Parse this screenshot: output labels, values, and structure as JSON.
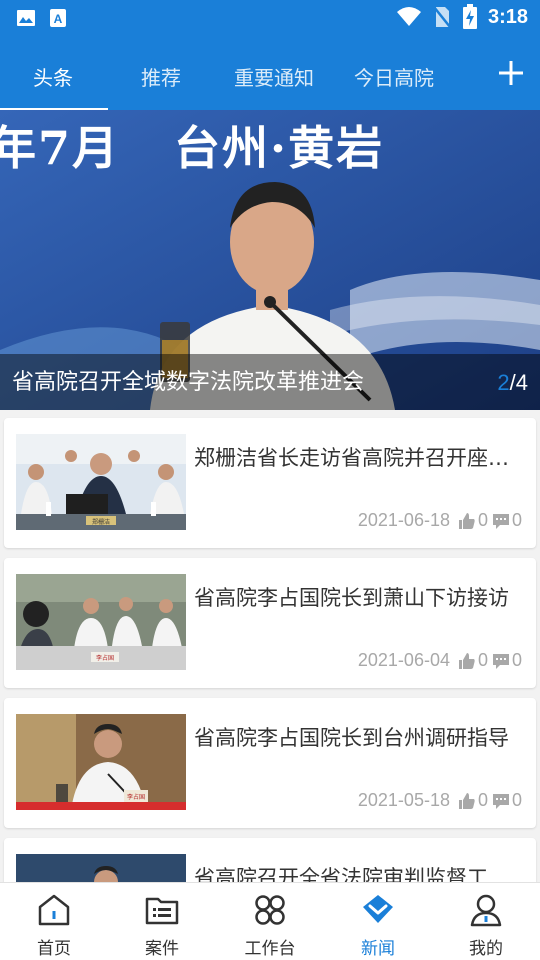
{
  "status_bar": {
    "time": "3:18",
    "icons": [
      "gallery-icon",
      "app-store-icon",
      "wifi-icon",
      "no-sim-icon",
      "battery-charging-icon"
    ]
  },
  "tabs": [
    {
      "label": "头条",
      "active": true
    },
    {
      "label": "推荐",
      "active": false
    },
    {
      "label": "重要通知",
      "active": false
    },
    {
      "label": "今日高院",
      "active": false
    }
  ],
  "add_tab_icon": "plus-icon",
  "hero": {
    "banner_text": "年7月   台州·黄岩",
    "caption": "省高院召开全域数字法院改革推进会",
    "current": "2",
    "total": "/4"
  },
  "news": [
    {
      "title": "郑栅洁省长走访省高院并召开座谈会",
      "date": "2021-06-18",
      "likes": "0",
      "comments": "0",
      "nameplate": "郑栅洁"
    },
    {
      "title": "省高院李占国院长到萧山下访接访",
      "date": "2021-06-04",
      "likes": "0",
      "comments": "0",
      "nameplate": "李占国"
    },
    {
      "title": "省高院李占国院长到台州调研指导",
      "date": "2021-05-18",
      "likes": "0",
      "comments": "0",
      "nameplate": "李占国"
    },
    {
      "title": "省高院召开全省法院审判监督工作会议",
      "date": "",
      "likes": "",
      "comments": ""
    }
  ],
  "bottom_nav": [
    {
      "label": "首页",
      "icon": "home-icon",
      "active": false
    },
    {
      "label": "案件",
      "icon": "case-folder-icon",
      "active": false
    },
    {
      "label": "工作台",
      "icon": "workbench-icon",
      "active": false
    },
    {
      "label": "新闻",
      "icon": "news-icon",
      "active": true
    },
    {
      "label": "我的",
      "icon": "profile-icon",
      "active": false
    }
  ],
  "colors": {
    "primary": "#1a7fd8",
    "meta_text": "#a8a8a8",
    "title_text": "#333333"
  }
}
